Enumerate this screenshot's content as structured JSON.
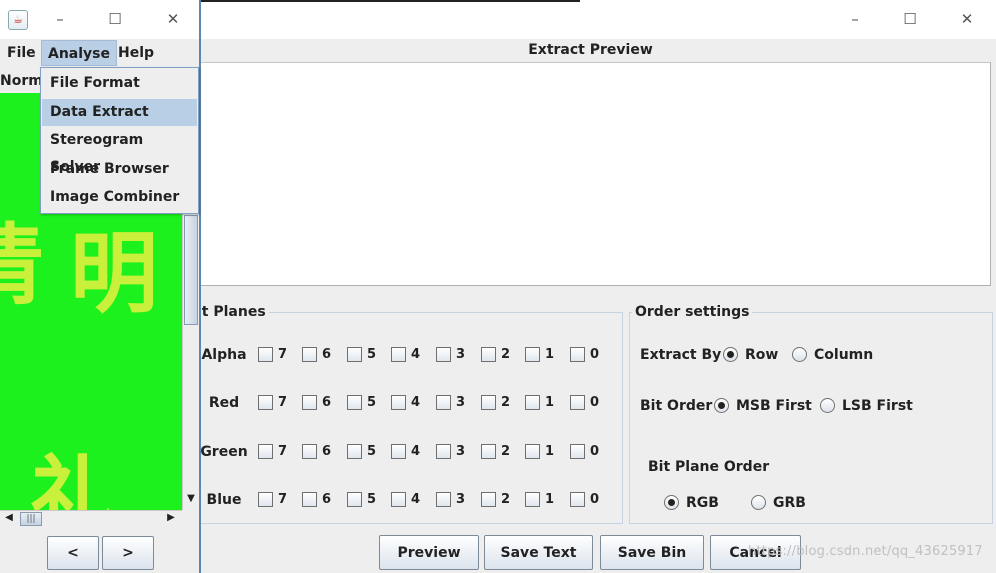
{
  "extract_window": {
    "preview_label": "Extract Preview",
    "bit_planes": {
      "title": "it Planes",
      "bits": [
        "7",
        "6",
        "5",
        "4",
        "3",
        "2",
        "1",
        "0"
      ],
      "channels": [
        "Alpha",
        "Red",
        "Green",
        "Blue"
      ]
    },
    "order_settings": {
      "title": "Order settings",
      "extract_by_label": "Extract By",
      "extract_by_options": [
        "Row",
        "Column"
      ],
      "extract_by_selected": "Row",
      "bit_order_label": "Bit Order",
      "bit_order_options": [
        "MSB First",
        "LSB First"
      ],
      "bit_order_selected": "MSB First",
      "bit_plane_order_label": "Bit Plane Order",
      "bit_plane_order_options": [
        "RGB",
        "GRB"
      ],
      "bit_plane_order_selected": "RGB"
    },
    "buttons": [
      "Preview",
      "Save Text",
      "Save Bin",
      "Cancel"
    ],
    "watermark": "https://blog.csdn.net/qq_43625917"
  },
  "main_window": {
    "title_controls": {
      "minimize": "–",
      "maximize": "☐",
      "close": "✕"
    },
    "menus": [
      "File",
      "Analyse",
      "Help"
    ],
    "active_menu": "Analyse",
    "analyse_menu_items": [
      "File Format",
      "Data Extract",
      "Stereogram Solver",
      "Frame Browser",
      "Image Combiner"
    ],
    "selected_menu_item": "Data Extract",
    "view_mode": "Norm",
    "image_glyphs": [
      "清",
      "明",
      "礼"
    ],
    "nav_buttons": [
      "<",
      ">"
    ]
  },
  "colors": {
    "image_green": "#1df11d",
    "glyph_yellow": "#c9f03a",
    "menu_highlight": "#b8cfe5"
  }
}
